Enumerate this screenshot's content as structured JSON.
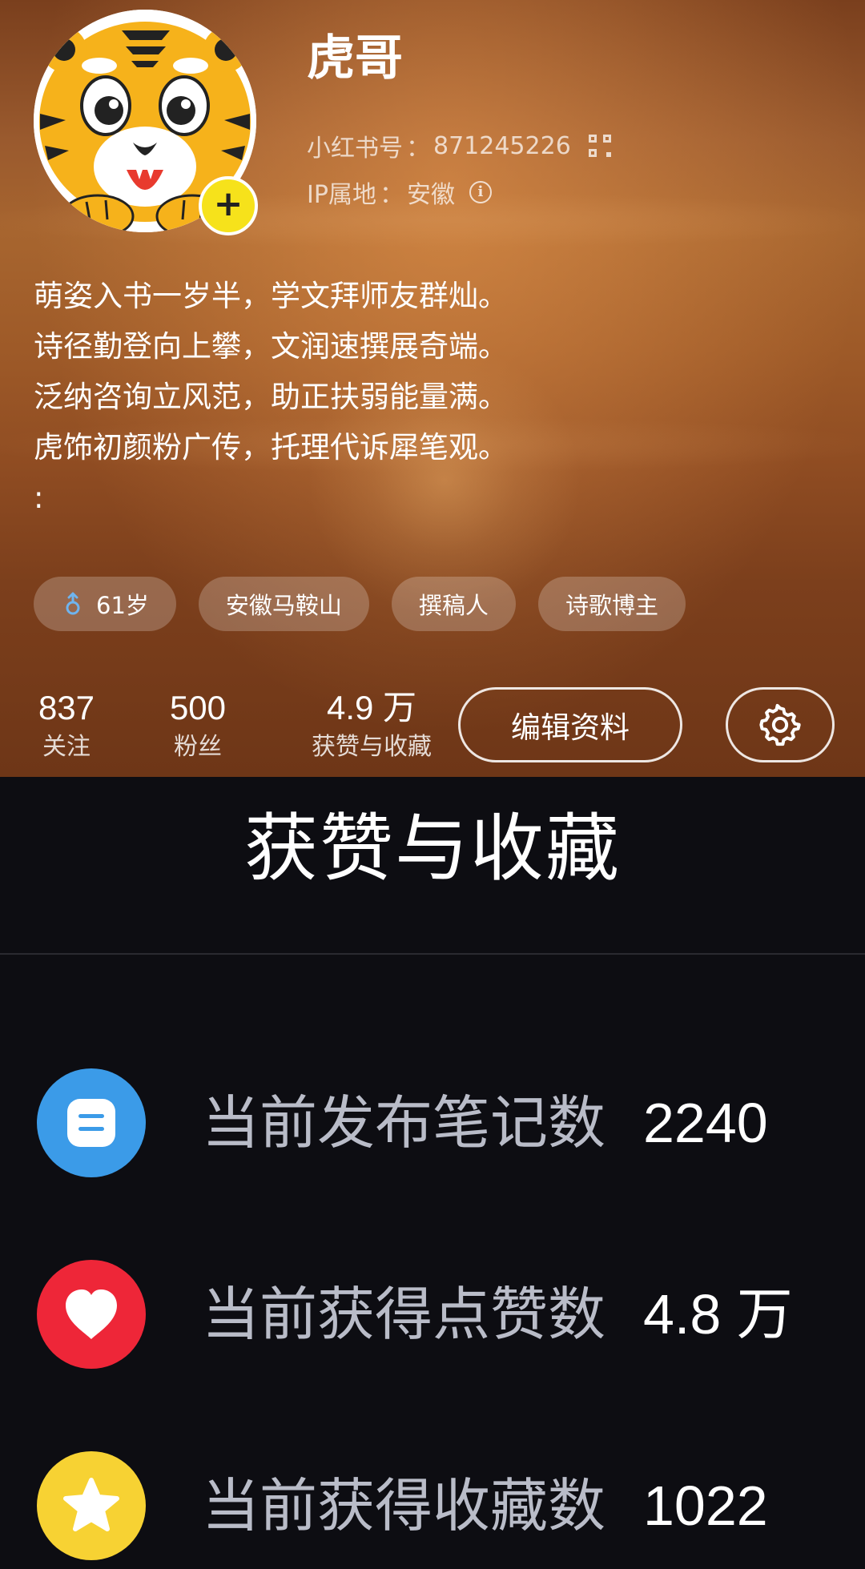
{
  "profile": {
    "username": "虎哥",
    "id_label": "小红书号",
    "id_value": "871245226",
    "ip_label": "IP属地",
    "ip_value": "安徽",
    "bio_lines": [
      "萌姿入书一岁半，学文拜师友群灿。",
      "诗径勤登向上攀，文润速撰展奇端。",
      "泛纳咨询立风范，助正扶弱能量满。",
      "虎饰初颜粉广传，托理代诉犀笔观。",
      ":"
    ],
    "tags": [
      "61岁",
      "安徽马鞍山",
      "撰稿人",
      "诗歌博主"
    ],
    "stats": {
      "following_num": "837",
      "following_label": "关注",
      "followers_num": "500",
      "followers_label": "粉丝",
      "likes_num": "4.9 万",
      "likes_label": "获赞与收藏"
    },
    "edit_label": "编辑资料",
    "icons": {
      "avatar": "tiger-cartoon-avatar",
      "add": "plus-icon",
      "qr": "qr-code-icon",
      "info": "info-icon",
      "gender": "male-icon",
      "settings": "gear-icon"
    }
  },
  "panel": {
    "title": "获赞与收藏",
    "rows": [
      {
        "label": "当前发布笔记数",
        "value": "2240",
        "icon": "note-icon",
        "color": "#3b9be8"
      },
      {
        "label": "当前获得点赞数",
        "value": "4.8 万",
        "icon": "heart-icon",
        "color": "#ee2638"
      },
      {
        "label": "当前获得收藏数",
        "value": "1022",
        "icon": "star-icon",
        "color": "#f7d233"
      }
    ]
  }
}
